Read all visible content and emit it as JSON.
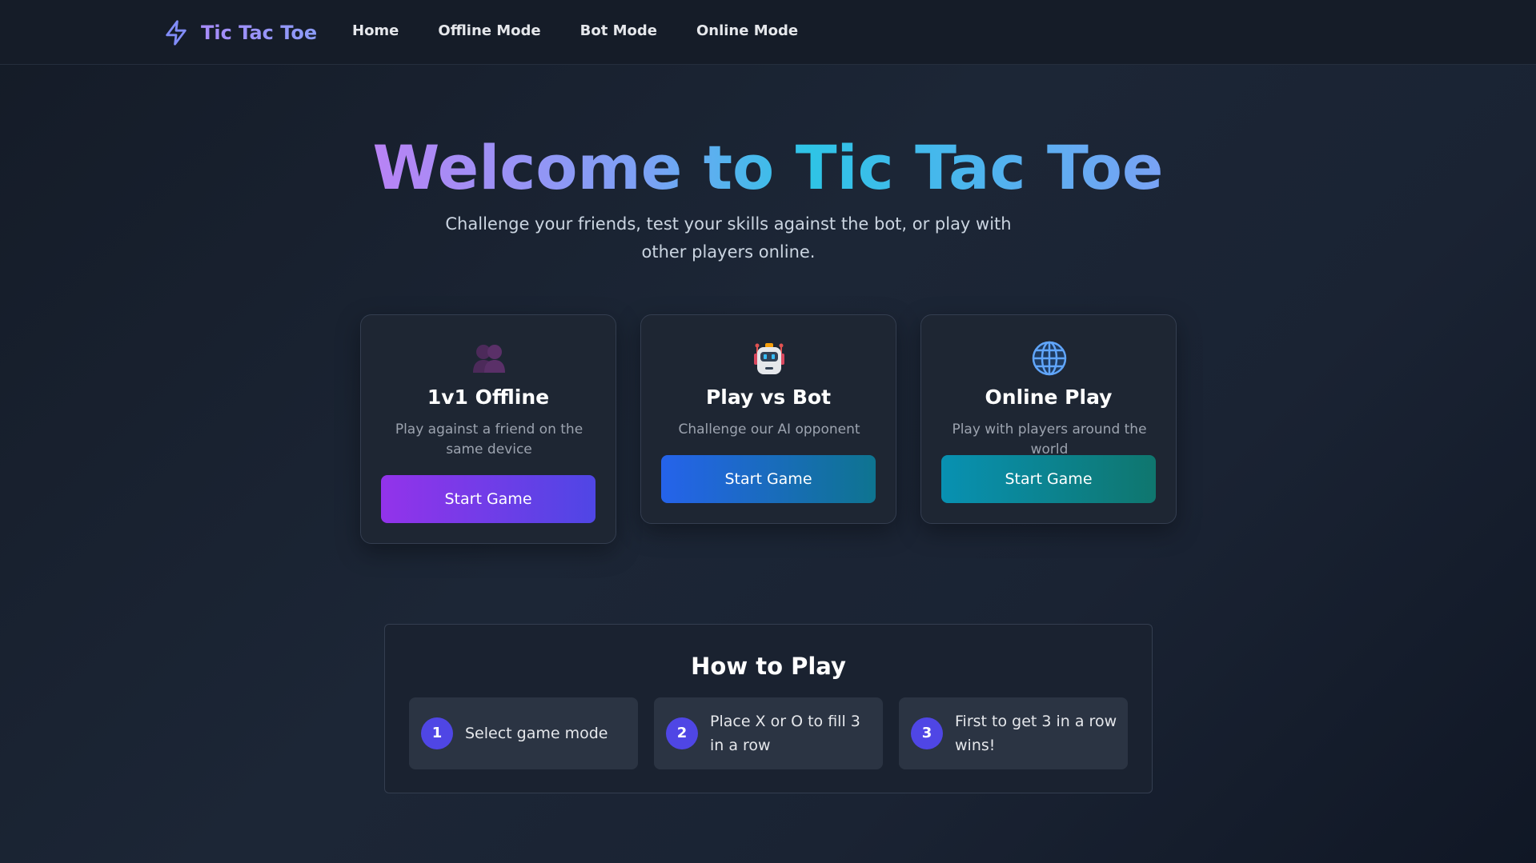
{
  "nav": {
    "brand": "Tic Tac Toe",
    "brand_icon": "lightning-icon",
    "links": [
      "Home",
      "Offline Mode",
      "Bot Mode",
      "Online Mode"
    ]
  },
  "hero": {
    "title": "Welcome to Tic Tac Toe",
    "subtitle": "Challenge your friends, test your skills against the bot, or play with other players online."
  },
  "modes": [
    {
      "icon": "two-people-icon",
      "title": "1v1 Offline",
      "description": "Play against a friend on the same device",
      "button": "Start Game"
    },
    {
      "icon": "robot-icon",
      "title": "Play vs Bot",
      "description": "Challenge our AI opponent",
      "button": "Start Game"
    },
    {
      "icon": "globe-icon",
      "title": "Online Play",
      "description": "Play with players around the world",
      "button": "Start Game"
    }
  ],
  "how_to_play": {
    "title": "How to Play",
    "steps": [
      {
        "number": "1",
        "text": "Select game mode"
      },
      {
        "number": "2",
        "text": "Place X or O to fill 3 in a row"
      },
      {
        "number": "3",
        "text": "First to get 3 in a row wins!"
      }
    ]
  },
  "colors": {
    "background": "#1c2636",
    "card": "#1e2633",
    "accent_purple": "#9333ea",
    "accent_indigo": "#4f46e5",
    "accent_blue": "#2563eb",
    "accent_teal": "#0891b2"
  }
}
